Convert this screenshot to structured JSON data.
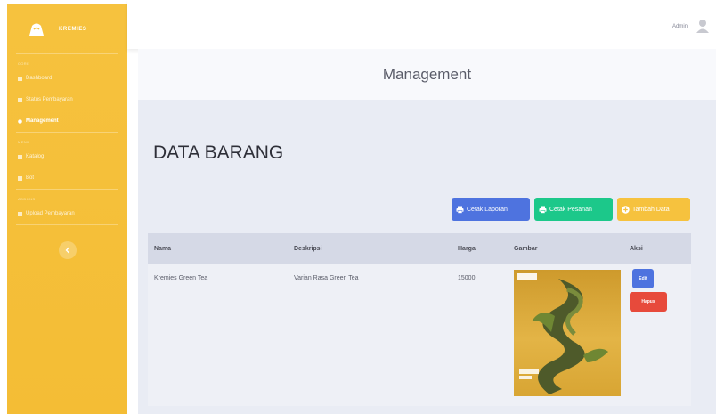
{
  "sidebar": {
    "brand": "KREMIES",
    "heading_1": "CORE",
    "heading_2": "MENU",
    "heading_3": "ADDONS",
    "items": [
      {
        "label": "Dashboard"
      },
      {
        "label": "Status Pembayaran"
      },
      {
        "label": "Management"
      },
      {
        "label": "Katalog"
      },
      {
        "label": "Bot"
      },
      {
        "label": "Upload Pembayaran"
      }
    ],
    "toggle_icon": "chevron-left-icon"
  },
  "topbar": {
    "user_name": "Admin"
  },
  "page": {
    "title": "Management"
  },
  "main": {
    "section_title": "DATA BARANG",
    "buttons": {
      "cetak_laporan": "Cetak Laporan",
      "cetak_pesanan": "Cetak Pesanan",
      "tambah_data": "Tambah Data"
    }
  },
  "table": {
    "headers": [
      "Nama",
      "Deskripsi",
      "Harga",
      "Gambar",
      "Aksi"
    ],
    "rows": [
      {
        "nama": "Kremies Green Tea",
        "deskripsi": "Varian Rasa Green Tea",
        "harga": "15000",
        "edit": "Edit",
        "hapus": "Hapus"
      }
    ]
  },
  "colors": {
    "sidebar": "#f6c23e",
    "primary": "#4e73df",
    "success": "#1cc88a",
    "warning": "#f6c23e",
    "danger": "#e74a3b"
  }
}
